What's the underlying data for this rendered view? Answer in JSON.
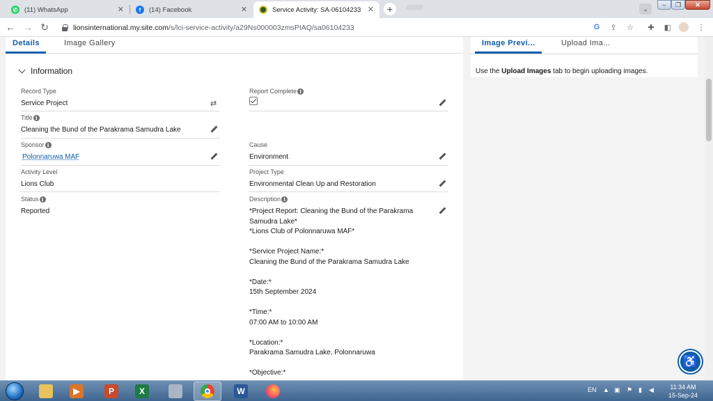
{
  "browser": {
    "tabs": [
      {
        "title": "(11) WhatsApp",
        "icon": "whatsapp-icon",
        "color": "#25d366",
        "active": false
      },
      {
        "title": "(14) Facebook",
        "icon": "facebook-icon",
        "color": "#1877f2",
        "active": false
      },
      {
        "title": "Service Activity: SA-06104233",
        "icon": "lions-icon",
        "color": "#2d5b2a",
        "active": true
      }
    ],
    "new_tab_symbol": "+",
    "url_host": "lionsinternational.my.site.com",
    "url_path": "/s/lci-service-activity/a29Ns000003zmsPIAQ/sa06104233"
  },
  "record": {
    "tabs": {
      "details": "Details",
      "gallery": "Image Gallery"
    },
    "section_title": "Information",
    "left_fields": {
      "record_type": {
        "label": "Record Type",
        "value": "Service Project"
      },
      "title": {
        "label": "Title",
        "value": "Cleaning the Bund of the Parakrama Samudra Lake"
      },
      "sponsor": {
        "label": "Sponsor",
        "value": "Polonnaruwa MAF"
      },
      "activity_level": {
        "label": "Activity Level",
        "value": "Lions Club"
      },
      "status": {
        "label": "Status",
        "value": "Reported"
      }
    },
    "right_fields": {
      "report_complete": {
        "label": "Report Complete",
        "checked": true
      },
      "cause": {
        "label": "Cause",
        "value": "Environment"
      },
      "project_type": {
        "label": "Project Type",
        "value": "Environmental Clean Up and Restoration"
      },
      "description": {
        "label": "Description",
        "lines": [
          "*Project Report: Cleaning the Bund of the Parakrama",
          "Samudra Lake*",
          "*Lions Club of Polonnaruwa MAF*",
          "",
          "*Service Project Name:*",
          "Cleaning the Bund of the Parakrama Samudra Lake",
          "",
          "*Date:*",
          "15th September 2024",
          "",
          "*Time:*",
          "07:00 AM to 10:00 AM",
          "",
          "*Location:*",
          "Parakrama Samudra Lake, Polonnaruwa",
          "",
          "*Objective:*"
        ]
      }
    }
  },
  "side": {
    "tabs": {
      "preview": "Image Previ...",
      "upload": "Upload Ima..."
    },
    "text_prefix": "Use the ",
    "text_bold": "Upload Images",
    "text_suffix": " tab to begin uploading images."
  },
  "taskbar": {
    "language": "EN",
    "time": "11:34 AM",
    "date": "15-Sep-24"
  }
}
